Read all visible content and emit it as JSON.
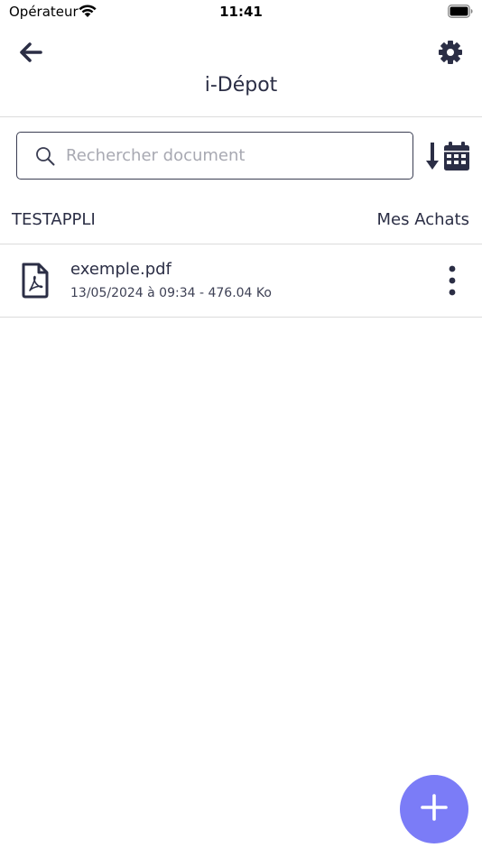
{
  "status_bar": {
    "carrier": "Opérateur",
    "time": "11:41",
    "wifi_icon": "wifi-icon",
    "battery_icon": "battery-icon"
  },
  "header": {
    "title": "i-Dépot",
    "back_icon": "arrow-left-icon",
    "settings_icon": "gear-icon"
  },
  "search": {
    "placeholder": "Rechercher document",
    "value": "",
    "icon": "search-icon",
    "sort_icon": "sort-by-date-icon"
  },
  "section": {
    "label": "TESTAPPLI",
    "link": "Mes Achats"
  },
  "documents": [
    {
      "name": "exemple.pdf",
      "meta": "13/05/2024 à 09:34 - 476.04 Ko",
      "icon": "pdf-file-icon",
      "menu_icon": "more-vertical-icon"
    }
  ],
  "fab": {
    "icon": "plus-icon"
  },
  "colors": {
    "primary_text": "#2b2e45",
    "divider": "#dcdcdc",
    "placeholder": "#a8a9b2",
    "fab": "#7b7cf7"
  }
}
